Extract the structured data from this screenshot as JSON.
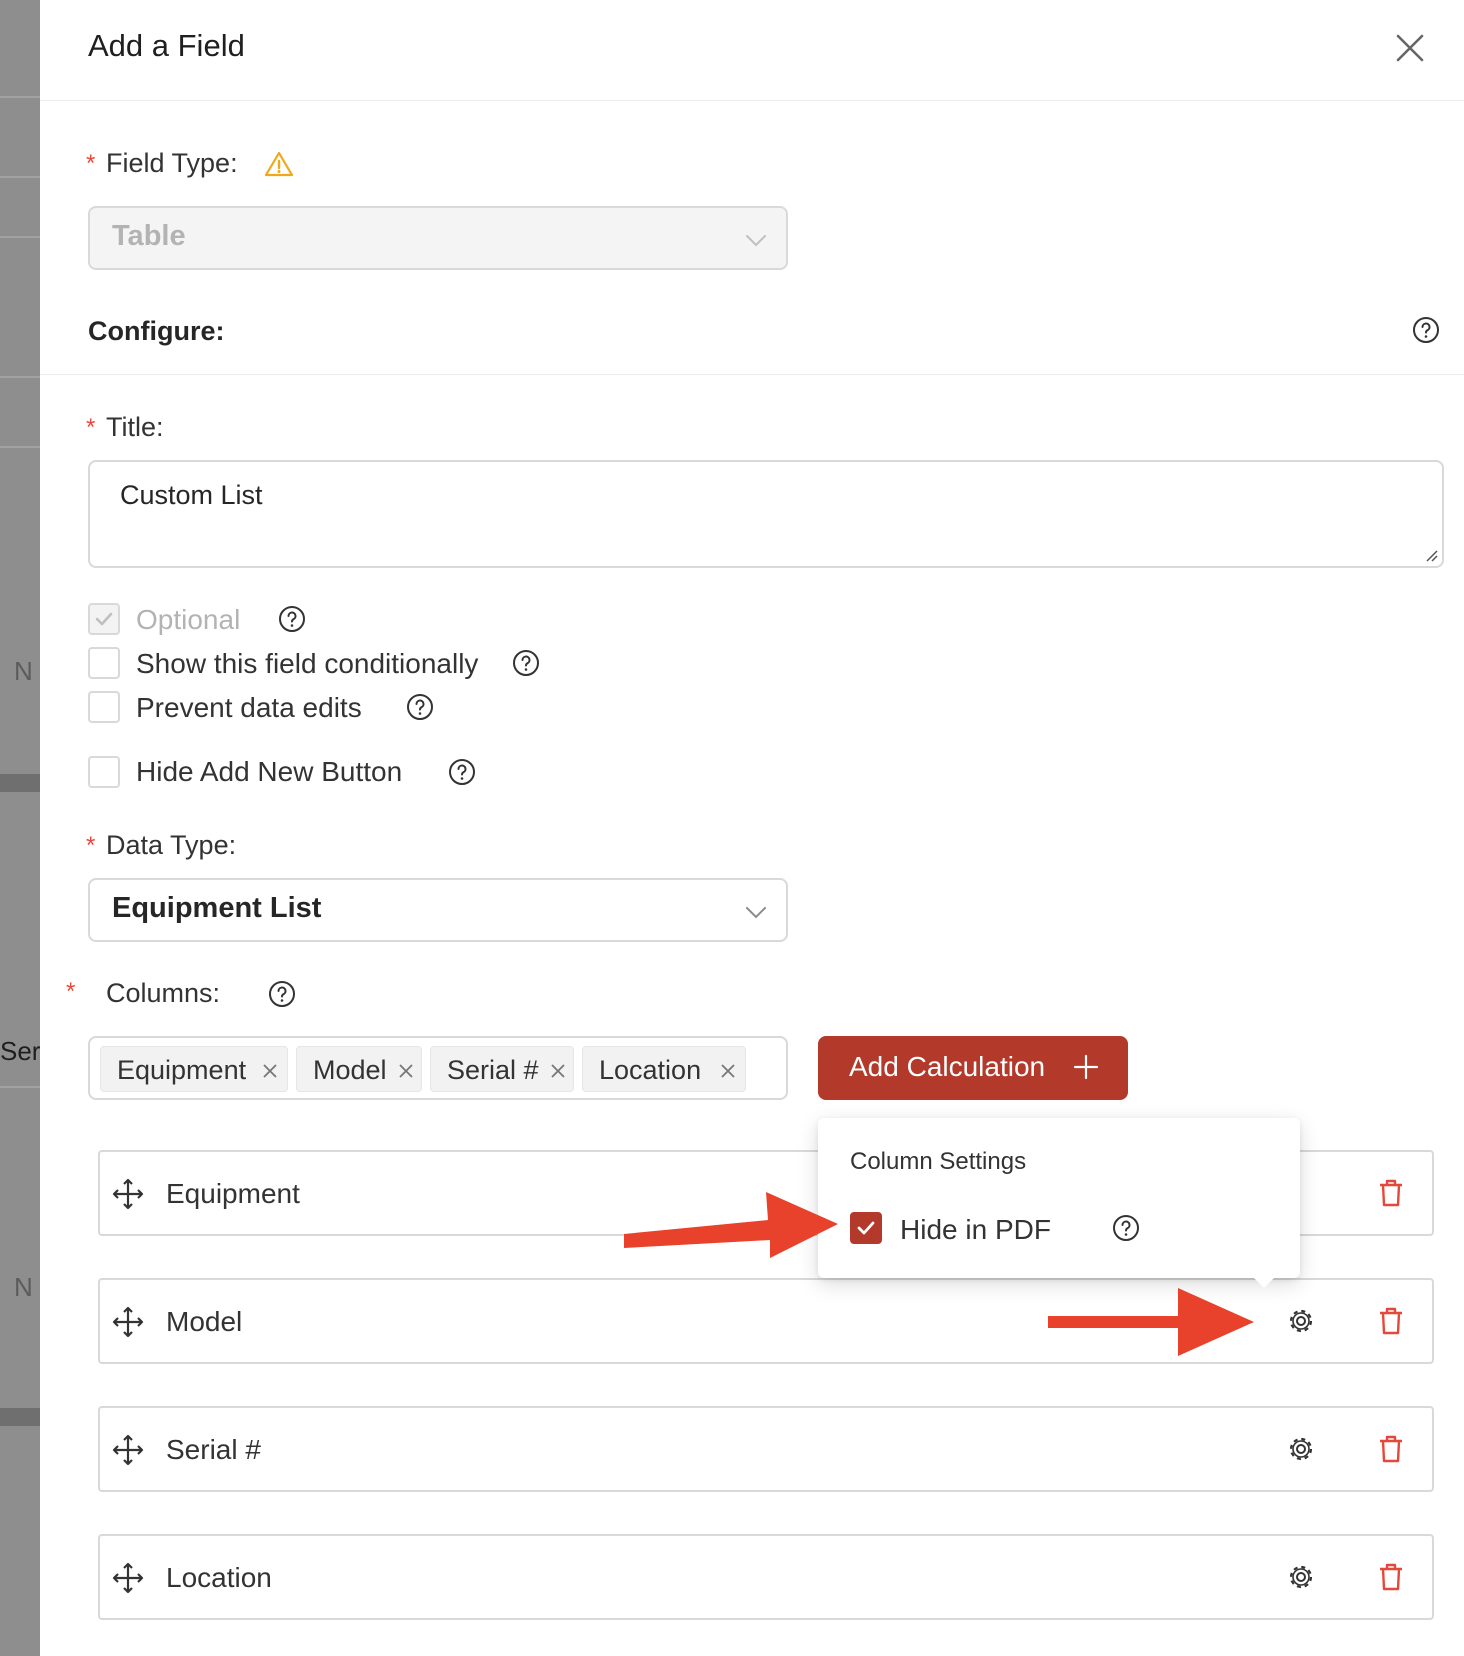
{
  "backdrop": {
    "text_ser": "Ser",
    "text_n1": "N",
    "text_n2": "N"
  },
  "header": {
    "title": "Add a Field"
  },
  "field_type": {
    "label": "Field Type:",
    "value": "Table"
  },
  "configure": {
    "label": "Configure:"
  },
  "title_field": {
    "label": "Title:",
    "value": "Custom List"
  },
  "options": {
    "optional": {
      "label": "Optional",
      "checked": true,
      "disabled": true
    },
    "show_conditionally": {
      "label": "Show this field conditionally",
      "checked": false
    },
    "prevent_edits": {
      "label": "Prevent data edits",
      "checked": false
    },
    "hide_add_new": {
      "label": "Hide Add New Button",
      "checked": false
    }
  },
  "data_type": {
    "label": "Data Type:",
    "value": "Equipment List"
  },
  "columns": {
    "label": "Columns:",
    "tags": [
      "Equipment",
      "Model",
      "Serial #",
      "Location"
    ],
    "add_calculation_label": "Add Calculation",
    "rows": [
      "Equipment",
      "Model",
      "Serial #",
      "Location"
    ]
  },
  "column_settings": {
    "title": "Column Settings",
    "hide_in_pdf_label": "Hide in PDF",
    "hide_in_pdf_checked": true
  },
  "colors": {
    "accent": "#b3392a",
    "required": "#e5483a",
    "warning": "#f0a81a",
    "annotation": "#e8412c",
    "delete": "#e5483a"
  },
  "icons": [
    "warning-icon",
    "help-icon",
    "close-icon",
    "chevron-down-icon",
    "move-icon",
    "gear-icon",
    "trash-icon",
    "plus-icon",
    "check-icon"
  ]
}
